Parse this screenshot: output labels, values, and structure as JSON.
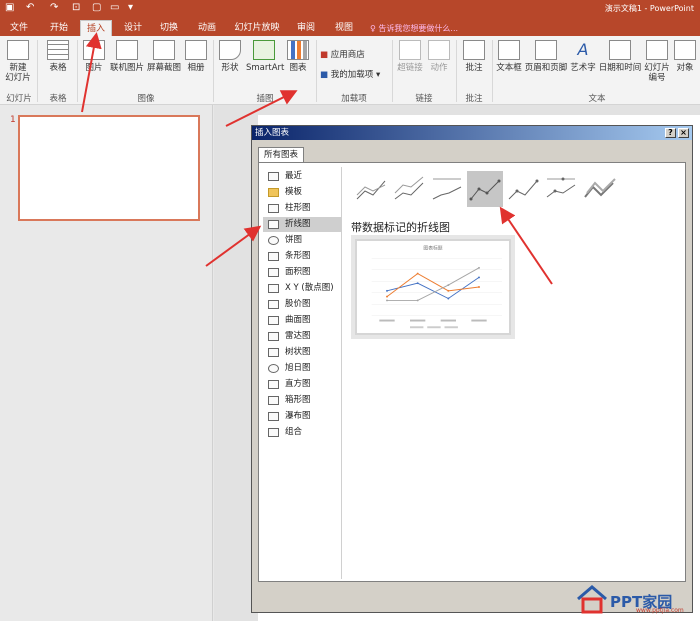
{
  "titlebar": {
    "doc_title": "演示文稿1 - PowerPoint"
  },
  "tabs": [
    {
      "label": "文件"
    },
    {
      "label": "开始"
    },
    {
      "label": "插入"
    },
    {
      "label": "设计"
    },
    {
      "label": "切换"
    },
    {
      "label": "动画"
    },
    {
      "label": "幻灯片放映"
    },
    {
      "label": "审阅"
    },
    {
      "label": "视图"
    }
  ],
  "tell_me": "告诉我您想要做什么...",
  "ribbon": {
    "buttons": [
      {
        "label": "新建\n幻灯片"
      },
      {
        "label": "表格"
      },
      {
        "label": "图片"
      },
      {
        "label": "联机图片"
      },
      {
        "label": "屏幕截图"
      },
      {
        "label": "相册"
      },
      {
        "label": "形状"
      },
      {
        "label": "SmartArt"
      },
      {
        "label": "图表"
      },
      {
        "label": "超链接"
      },
      {
        "label": "动作"
      },
      {
        "label": "批注"
      },
      {
        "label": "文本框"
      },
      {
        "label": "页眉和页脚"
      },
      {
        "label": "艺术字"
      },
      {
        "label": "日期和时间"
      },
      {
        "label": "幻灯片\n编号"
      },
      {
        "label": "对象"
      }
    ],
    "addins": {
      "store": "应用商店",
      "my_addins": "我的加载项"
    },
    "groups": [
      "幻灯片",
      "表格",
      "图像",
      "插图",
      "加载项",
      "链接",
      "批注",
      "文本"
    ]
  },
  "slides": [
    {
      "number": "1"
    }
  ],
  "dialog": {
    "title": "插入图表",
    "help": "?",
    "close": "×",
    "tab": "所有图表",
    "categories": [
      {
        "label": "最近",
        "icon": "recent-icon"
      },
      {
        "label": "模板",
        "icon": "folder-icon"
      },
      {
        "label": "柱形图",
        "icon": "column-chart-icon"
      },
      {
        "label": "折线图",
        "icon": "line-chart-icon",
        "selected": true
      },
      {
        "label": "饼图",
        "icon": "pie-chart-icon"
      },
      {
        "label": "条形图",
        "icon": "bar-chart-icon"
      },
      {
        "label": "面积图",
        "icon": "area-chart-icon"
      },
      {
        "label": "X Y (散点图)",
        "icon": "scatter-chart-icon"
      },
      {
        "label": "股价图",
        "icon": "stock-chart-icon"
      },
      {
        "label": "曲面图",
        "icon": "surface-chart-icon"
      },
      {
        "label": "雷达图",
        "icon": "radar-chart-icon"
      },
      {
        "label": "树状图",
        "icon": "treemap-chart-icon"
      },
      {
        "label": "旭日图",
        "icon": "sunburst-chart-icon"
      },
      {
        "label": "直方图",
        "icon": "histogram-chart-icon"
      },
      {
        "label": "箱形图",
        "icon": "box-whisker-chart-icon"
      },
      {
        "label": "瀑布图",
        "icon": "waterfall-chart-icon"
      },
      {
        "label": "组合",
        "icon": "combo-chart-icon"
      }
    ],
    "chart_subtypes": 7,
    "selected_subtype_index": 3,
    "chart_type_title": "带数据标记的折线图",
    "preview_title": "图表标题"
  },
  "watermark": {
    "text": "PPT家园",
    "sub": "www.pptjia.com"
  },
  "colors": {
    "accent": "#b7472a",
    "arrow": "#e0322f"
  }
}
